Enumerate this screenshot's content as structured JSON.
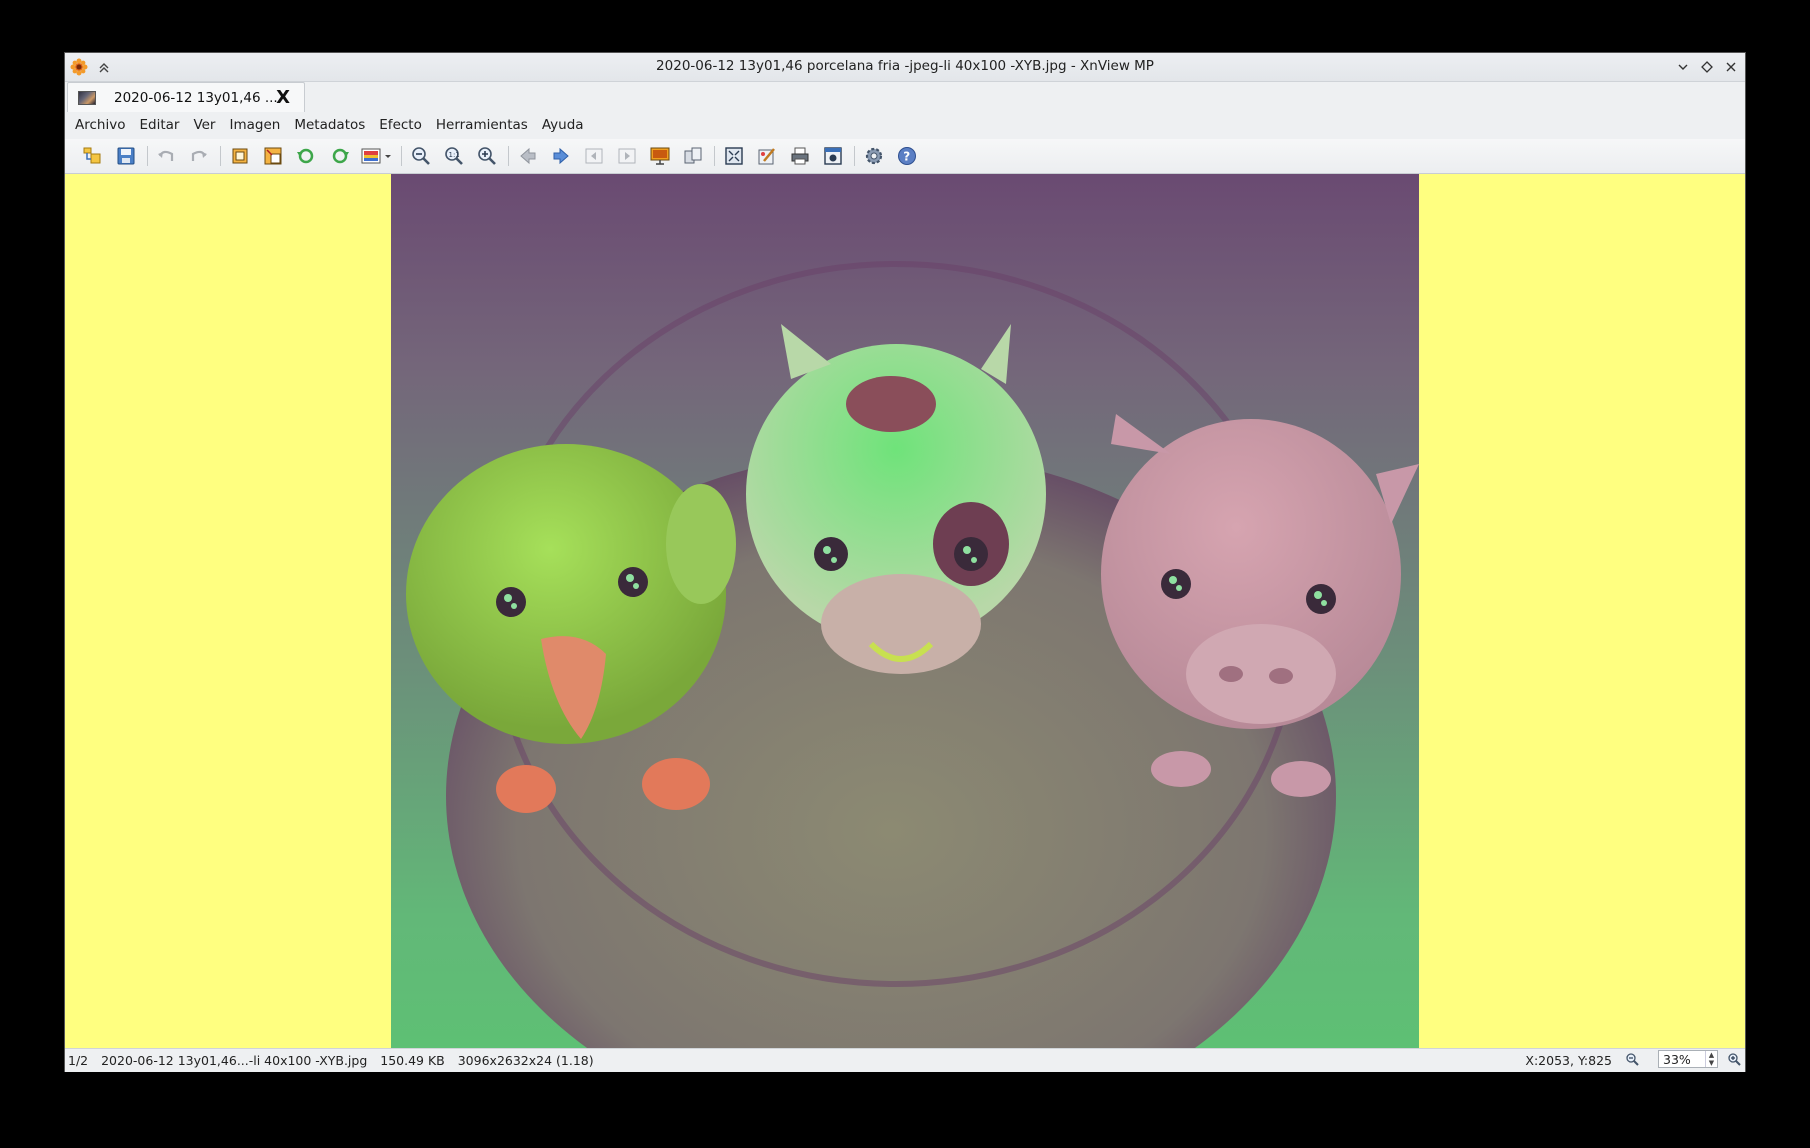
{
  "window": {
    "title": "2020-06-12 13y01,46 porcelana fria -jpeg-li 40x100 -XYB.jpg - XnView MP",
    "app_icon": "xnview-flower-icon",
    "controls": [
      "minimize-icon",
      "maximize-icon",
      "close-icon"
    ]
  },
  "tab": {
    "label": "2020-06-12 13y01,46 ...",
    "close": "X"
  },
  "menu": [
    "Archivo",
    "Editar",
    "Ver",
    "Imagen",
    "Metadatos",
    "Efecto",
    "Herramientas",
    "Ayuda"
  ],
  "toolbar": {
    "icons": [
      "browser-icon",
      "save-icon",
      "undo-icon",
      "redo-icon",
      "crop-icon",
      "resize-icon",
      "rotate-left-icon",
      "rotate-right-icon",
      "adjust-colors-icon",
      "zoom-out-icon",
      "zoom-fit-icon",
      "zoom-in-icon",
      "previous-icon",
      "next-icon",
      "first-icon",
      "last-icon",
      "slideshow-icon",
      "compare-icon",
      "fullscreen-icon",
      "edit-icon",
      "print-icon",
      "capture-icon",
      "settings-icon",
      "help-icon"
    ]
  },
  "viewer": {
    "background_color": "#ffff80",
    "image_description_colors": {
      "top": "#6a4a72",
      "bottom": "#5ec074"
    }
  },
  "status": {
    "index": "1/2",
    "filename": "2020-06-12 13y01,46...-li 40x100 -XYB.jpg",
    "filesize": "150.49 KB",
    "dimensions": "3096x2632x24 (1.18)",
    "coords": "X:2053, Y:825",
    "zoom": "33%"
  }
}
